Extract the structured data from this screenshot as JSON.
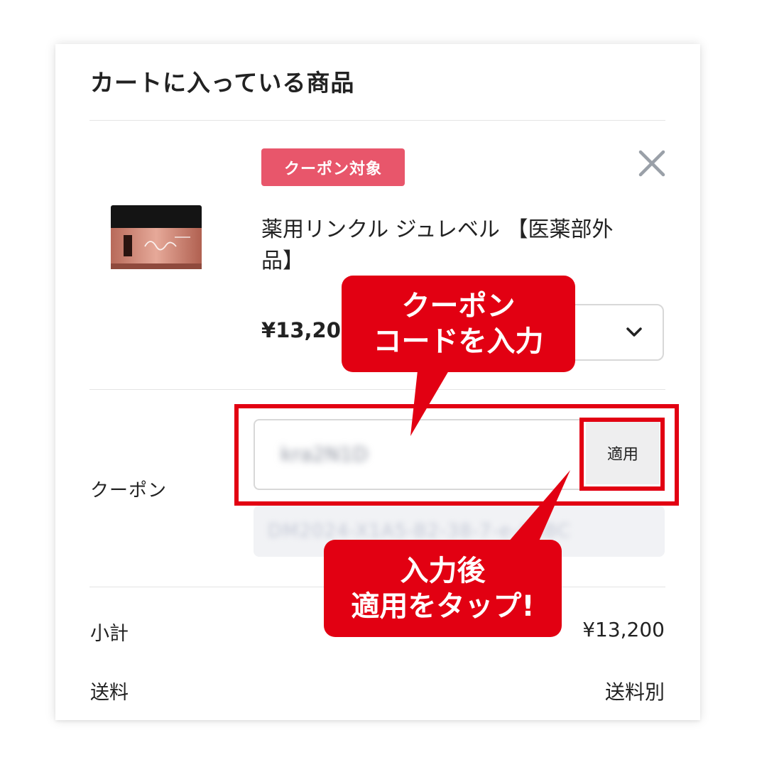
{
  "cart": {
    "title": "カートに入っている商品",
    "item": {
      "badge": "クーポン対象",
      "name": "薬用リンクル ジュレベル 【医薬部外品】",
      "price": "¥13,200"
    }
  },
  "coupon": {
    "label": "クーポン",
    "input_value": "kra2N1D",
    "apply_label": "適用",
    "code": "DM2024-X1A5-B2-38-7-e-A4BC"
  },
  "callouts": {
    "first": {
      "line1": "クーポン",
      "line2": "コードを入力"
    },
    "second": {
      "line1": "入力後",
      "line2": "適用をタップ!"
    }
  },
  "summary": {
    "subtotal_label": "小計",
    "subtotal_value": "¥13,200",
    "shipping_label": "送料",
    "shipping_value": "送料別"
  },
  "colors": {
    "accent_red": "#e20012",
    "badge_pink": "#e8566b"
  }
}
